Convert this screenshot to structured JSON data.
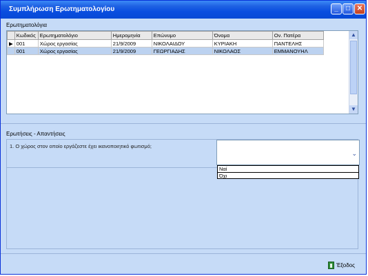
{
  "window": {
    "title": "Συμπλήρωση Ερωτηματολογίου"
  },
  "titlebar_buttons": {
    "minimize": "_",
    "maximize": "□",
    "close": "✕"
  },
  "questionnaires": {
    "label": "Ερωτηματολόγια",
    "columns": [
      "Κωδικός",
      "Ερωτηματολόγιο",
      "Ημερομηνία",
      "Επώνυμο",
      "Όνομα",
      "Ον. Πατέρα"
    ],
    "rows": [
      [
        "001",
        "Χώρος εργασίας",
        "21/9/2009",
        "ΝΙΚΟΛΑΙΔΟΥ",
        "ΚΥΡΙΑΚΗ",
        "ΠΑΝΤΕΛΗΣ"
      ],
      [
        "001",
        "Χώρος εργασίας",
        "21/9/2009",
        "ΓΕΩΡΓΙΑΔΗΣ",
        "ΝΙΚΟΛΑΟΣ",
        "ΕΜΜΑΝΟΥΗΛ"
      ]
    ],
    "current_row_marker": "▶"
  },
  "qa": {
    "label": "Ερωτήσεις - Απαντήσεις",
    "question": "1. Ο χώρος στον οποίο εργάζεστε έχει ικανοποιητικό φωτισμό;",
    "answer_value": "",
    "options": [
      "Ναί",
      "Όχι"
    ]
  },
  "footer": {
    "exit_label": "Έξοδος"
  },
  "icons": {
    "dropdown": "chevron-down-icon",
    "exit": "exit-door-icon"
  }
}
